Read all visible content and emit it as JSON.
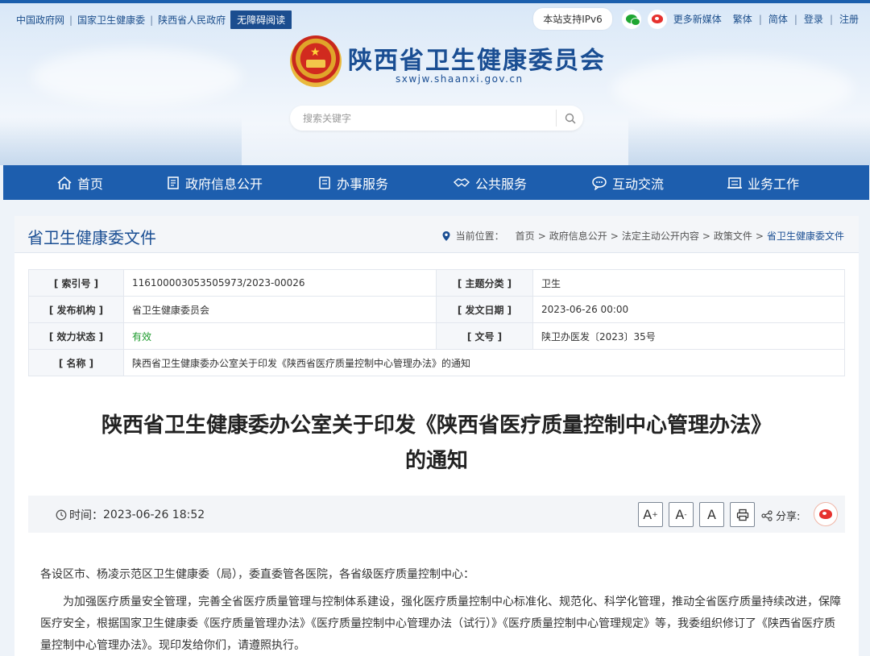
{
  "toplinks": [
    "中国政府网",
    "国家卫生健康委",
    "陕西省人民政府"
  ],
  "accessibility_label": "无障碍阅读",
  "topright": {
    "ipv6": "本站支持IPv6",
    "more_media": "更多新媒体",
    "traditional": "繁体",
    "simplified": "简体",
    "login": "登录",
    "register": "注册"
  },
  "site": {
    "title": "陕西省卫生健康委员会",
    "domain": "sxwjw.shaanxi.gov.cn"
  },
  "search": {
    "placeholder": "搜索关键字"
  },
  "nav": [
    "首页",
    "政府信息公开",
    "办事服务",
    "公共服务",
    "互动交流",
    "业务工作"
  ],
  "section_title": "省卫生健康委文件",
  "breadcrumb": {
    "label": "当前位置：",
    "items": [
      "首页",
      "政府信息公开",
      "法定主动公开内容",
      "政策文件",
      "省卫生健康委文件"
    ]
  },
  "meta": {
    "index_label": "[ 索引号 ]",
    "index_value": "11610000305350597З/2023-00026",
    "topic_label": "[ 主题分类 ]",
    "topic_value": "卫生",
    "issuer_label": "[ 发布机构 ]",
    "issuer_value": "省卫生健康委员会",
    "date_label": "[ 发文日期 ]",
    "date_value": "2023-06-26 00:00",
    "status_label": "[ 效力状态 ]",
    "status_value": "有效",
    "docno_label": "[ 文号 ]",
    "docno_value": "陕卫办医发〔2023〕35号",
    "name_label": "[ 名称 ]",
    "name_value": "陕西省卫生健康委办公室关于印发《陕西省医疗质量控制中心管理办法》的通知"
  },
  "doc_title_line1": "陕西省卫生健康委办公室关于印发《陕西省医疗质量控制中心管理办法》",
  "doc_title_line2": "的通知",
  "time_label": "时间：",
  "time_value": "2023-06-26 18:52",
  "font_buttons": [
    "A",
    "A",
    "A"
  ],
  "share_label": "分享:",
  "body": {
    "salutation": "各设区市、杨凌示范区卫生健康委（局），委直委管各医院，各省级医疗质量控制中心：",
    "paragraph": "为加强医疗质量安全管理，完善全省医疗质量管理与控制体系建设，强化医疗质量控制中心标准化、规范化、科学化管理，推动全省医疗质量持续改进，保障医疗安全，根据国家卫生健康委《医疗质量管理办法》《医疗质量控制中心管理办法（试行）》《医疗质量控制中心管理规定》等，我委组织修订了《陕西省医疗质量控制中心管理办法》。现印发给你们，请遵照执行。"
  }
}
